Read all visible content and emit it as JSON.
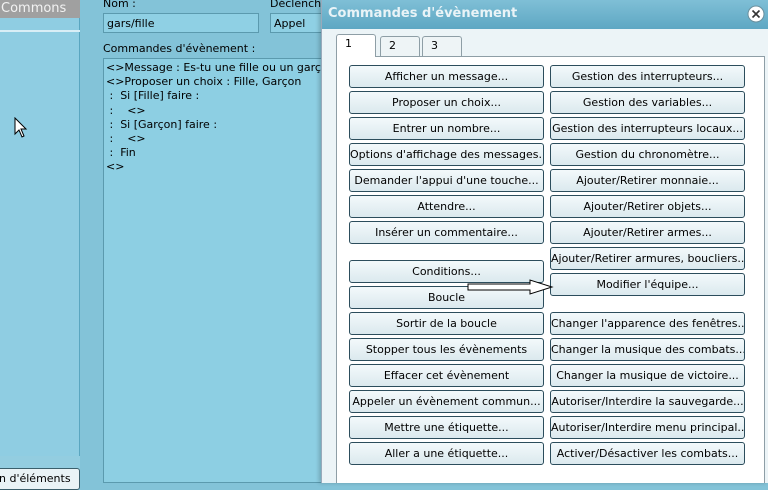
{
  "background": {
    "left_title": "Commons",
    "left_bottom_button": "n d'éléments",
    "name_label": "Nom :",
    "name_value": "gars/fille",
    "trigger_label": "Déclenche",
    "trigger_value": "Appel",
    "commands_label": "Commandes d'évènement :",
    "command_lines": [
      "<>Message : Es-tu une fille ou un garçon?",
      "<>Proposer un choix : Fille, Garçon",
      " :  Si [Fille] faire :",
      " :    <>",
      " :  Si [Garçon] faire :",
      " :    <>",
      " :  Fin",
      "<>"
    ]
  },
  "dialog": {
    "title": "Commandes d'évènement",
    "tabs": [
      "1",
      "2",
      "3"
    ],
    "active_tab": "1",
    "left_buttons": [
      "Afficher un message...",
      "Proposer un choix...",
      "Entrer un nombre...",
      "Options d'affichage des messages...",
      "Demander l'appui d'une touche...",
      "Attendre...",
      "Insérer un commentaire...",
      "Conditions...",
      "Boucle",
      "Sortir de la boucle",
      "Stopper tous les évènements",
      "Effacer cet évènement",
      "Appeler un évènement commun...",
      "Mettre une étiquette...",
      "Aller a une étiquette..."
    ],
    "right_buttons": [
      "Gestion des interrupteurs...",
      "Gestion des variables...",
      "Gestion des interrupteurs locaux...",
      "Gestion du chronomètre...",
      "Ajouter/Retirer monnaie...",
      "Ajouter/Retirer objets...",
      "Ajouter/Retirer armes...",
      "Ajouter/Retirer armures, boucliers...",
      "Modifier l'équipe...",
      "Changer l'apparence des fenêtres...",
      "Changer la musique des combats...",
      "Changer la musique de victoire...",
      "Autoriser/Interdire la sauvegarde...",
      "Autoriser/Interdire menu principal...",
      "Activer/Désactiver les combats..."
    ]
  },
  "colors": {
    "background_blue": "#83c3d8",
    "titlebar": "#6fb4cc",
    "button_border": "#2c4d5c"
  }
}
